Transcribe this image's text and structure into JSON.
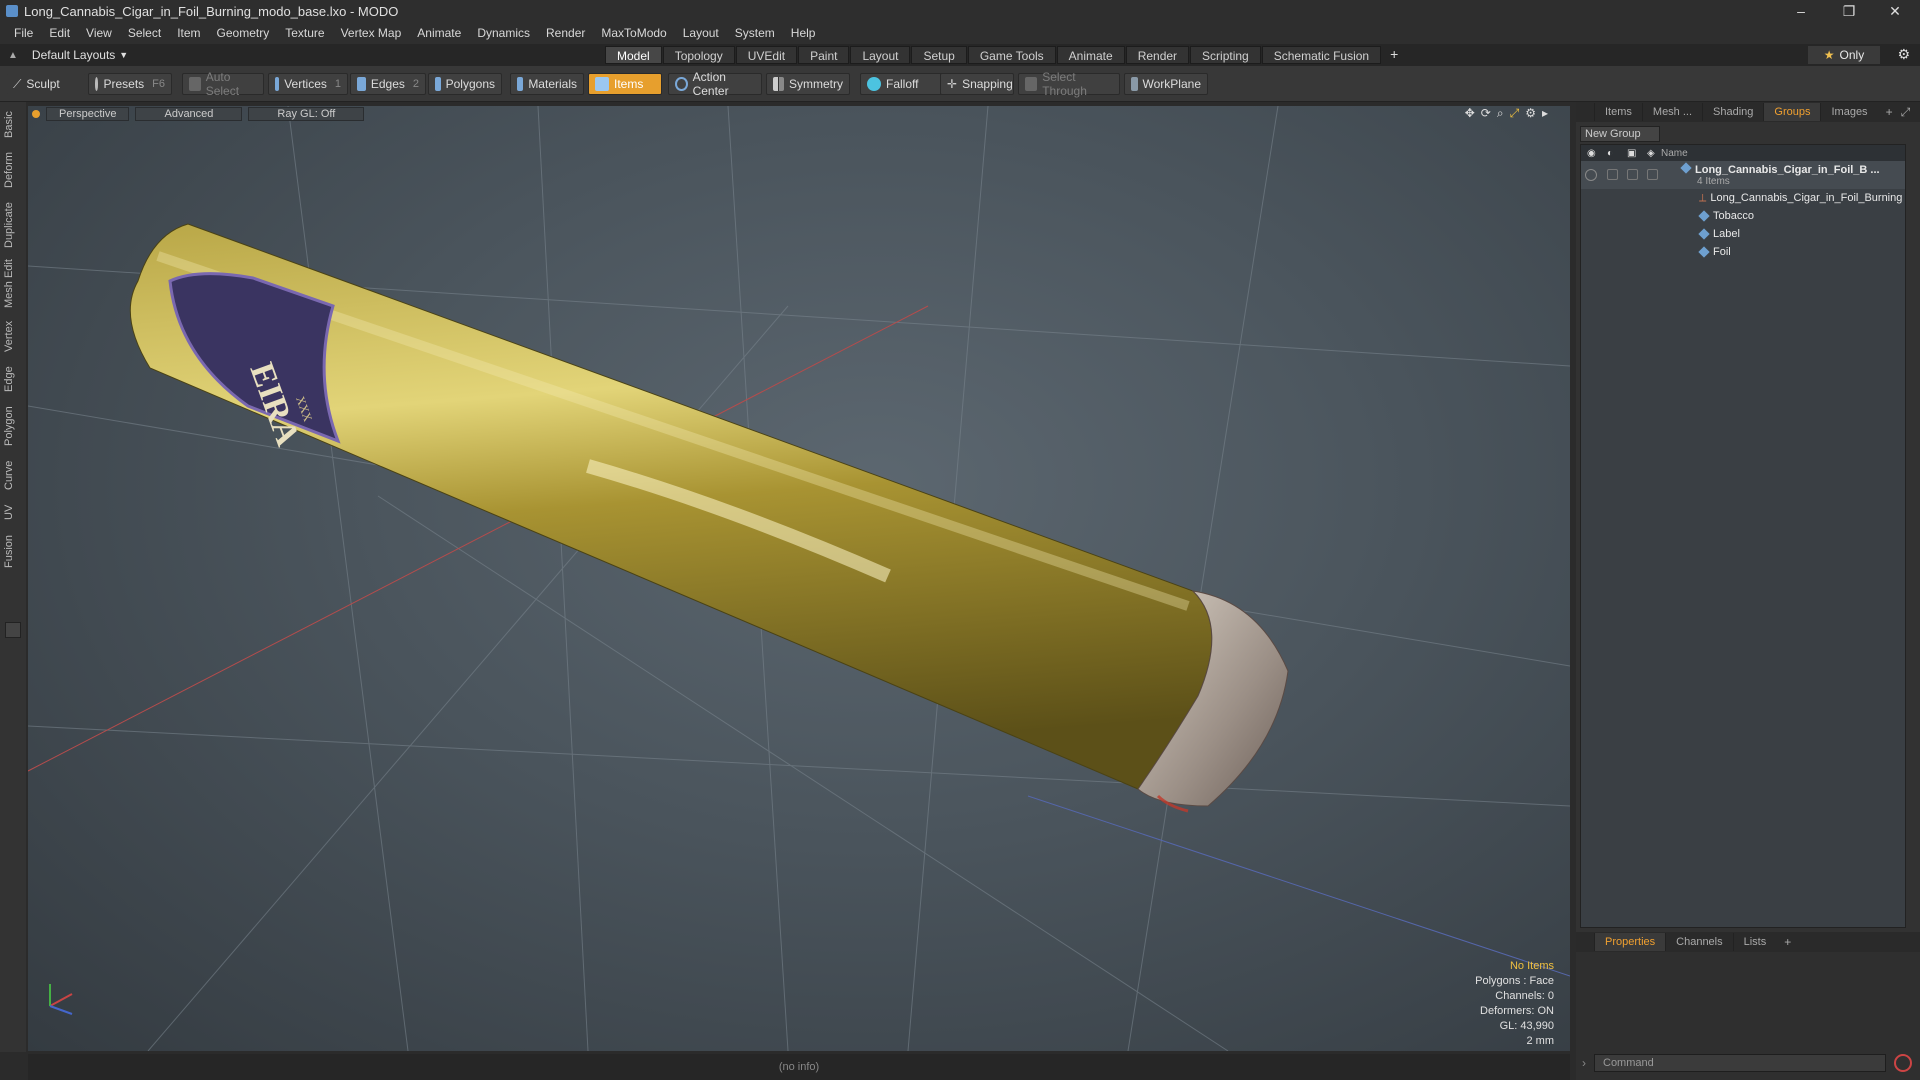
{
  "window": {
    "title": "Long_Cannabis_Cigar_in_Foil_Burning_modo_base.lxo - MODO",
    "controls": [
      "–",
      "❐",
      "✕"
    ]
  },
  "menu": [
    "File",
    "Edit",
    "View",
    "Select",
    "Item",
    "Geometry",
    "Texture",
    "Vertex Map",
    "Animate",
    "Dynamics",
    "Render",
    "MaxToModo",
    "Layout",
    "System",
    "Help"
  ],
  "layout_selector": "Default Layouts",
  "mode_tabs": [
    "Model",
    "Topology",
    "UVEdit",
    "Paint",
    "Layout",
    "Setup",
    "Game Tools",
    "Animate",
    "Render",
    "Scripting",
    "Schematic Fusion"
  ],
  "mode_add": "+",
  "only_label": "Only",
  "toolbar": {
    "sculpt": "Sculpt",
    "presets": "Presets",
    "presets_key": "F6",
    "auto_select": "Auto Select",
    "vertices": "Vertices",
    "vertices_count": "1",
    "edges": "Edges",
    "edges_count": "2",
    "polygons": "Polygons",
    "materials": "Materials",
    "items": "Items",
    "action_center": "Action Center",
    "symmetry": "Symmetry",
    "falloff": "Falloff",
    "snapping": "Snapping",
    "select_through": "Select Through",
    "workplane": "WorkPlane"
  },
  "left_tabs": [
    "Basic",
    "Deform",
    "Duplicate",
    "Mesh Edit",
    "Vertex",
    "Edge",
    "Polygon",
    "Curve",
    "UV",
    "Fusion"
  ],
  "viewport": {
    "view_mode": "Perspective",
    "shading": "Advanced",
    "raygl": "Ray GL: Off",
    "label_text_1": "EIRA",
    "label_text_2": "XXX",
    "hud": {
      "no_items": "No Items",
      "polygons": "Polygons : Face",
      "channels": "Channels: 0",
      "deformers": "Deformers: ON",
      "gl": "GL: 43,990",
      "unit": "2 mm"
    }
  },
  "status": "(no info)",
  "right_panel": {
    "tabs": [
      "Items",
      "Mesh ...",
      "Shading",
      "Groups",
      "Images"
    ],
    "active_tab": "Groups",
    "new_group": "New Group",
    "column_name": "Name",
    "group_name": "Long_Cannabis_Cigar_in_Foil_B ...",
    "group_count": "4 Items",
    "children": [
      "Long_Cannabis_Cigar_in_Foil_Burning",
      "Tobacco",
      "Label",
      "Foil"
    ]
  },
  "bottom_panel": {
    "tabs": [
      "Properties",
      "Channels",
      "Lists"
    ],
    "command_placeholder": "Command"
  },
  "colors": {
    "accent": "#e79f2d",
    "active_tab_text": "#f0a030",
    "hud_warning": "#f0c040"
  }
}
